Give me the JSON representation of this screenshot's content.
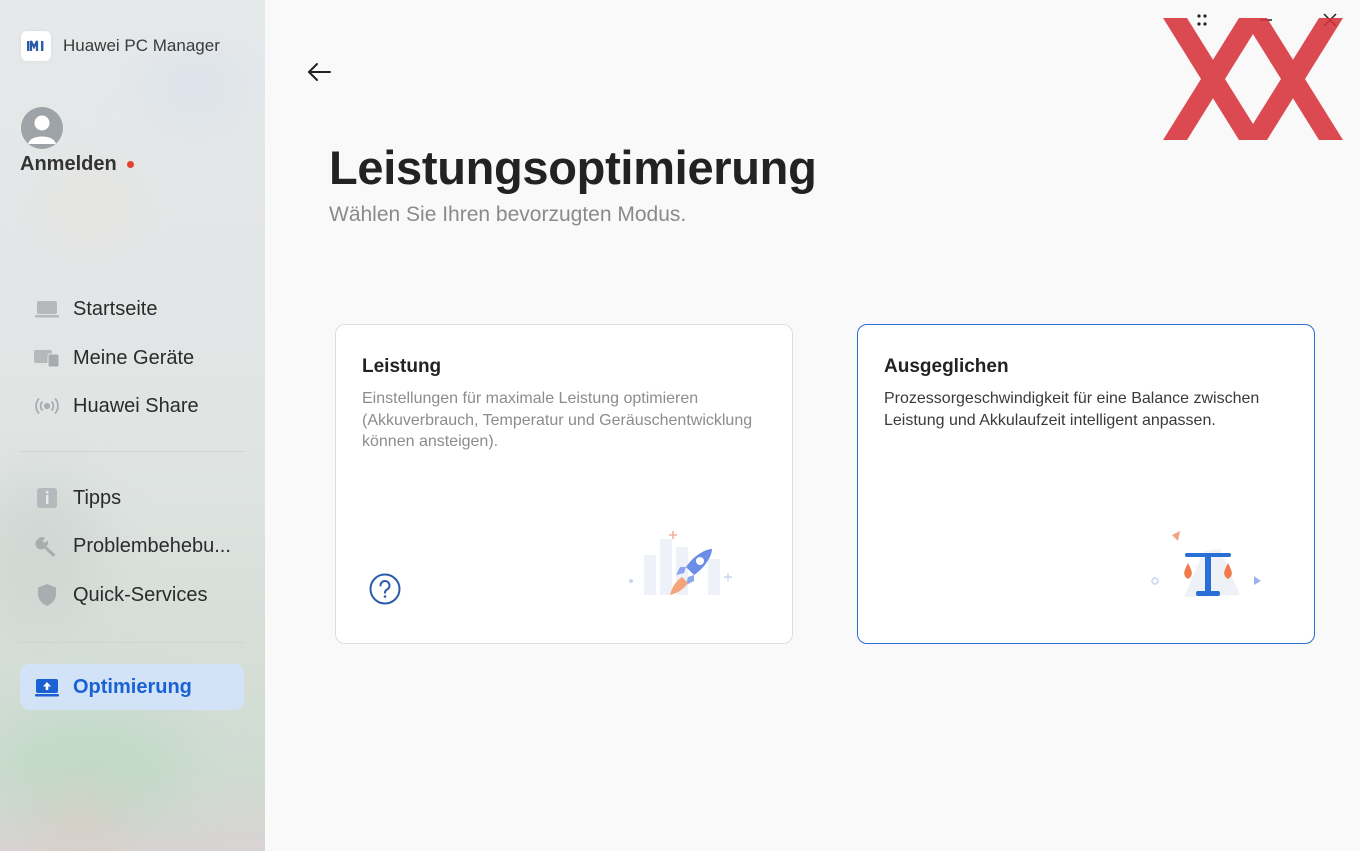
{
  "app": {
    "title": "Huawei PC Manager",
    "logo": "huawei-pc-manager-logo"
  },
  "user": {
    "login_label": "Anmelden",
    "notification_color": "#e0432f"
  },
  "sidebar": {
    "items": [
      {
        "label": "Startseite",
        "icon": "laptop-icon"
      },
      {
        "label": "Meine Geräte",
        "icon": "devices-icon"
      },
      {
        "label": "Huawei Share",
        "icon": "wireless-icon"
      },
      {
        "label": "Tipps",
        "icon": "info-icon"
      },
      {
        "label": "Problembehebu...",
        "icon": "wrench-icon"
      },
      {
        "label": "Quick-Services",
        "icon": "shield-icon"
      },
      {
        "label": "Optimierung",
        "icon": "optimize-icon",
        "active": true
      }
    ]
  },
  "main": {
    "title": "Leistungsoptimierung",
    "subtitle": "Wählen Sie Ihren bevorzugten Modus.",
    "cards": [
      {
        "title": "Leistung",
        "description": "Einstellungen für maximale Leistung optimieren (Akkuverbrauch, Temperatur und Geräuschentwicklung können ansteigen).",
        "icon": "rocket-icon",
        "selected": false
      },
      {
        "title": "Ausgeglichen",
        "description": "Prozessorgeschwindigkeit für eine Balance zwischen Leistung und Akkulaufzeit intelligent anpassen.",
        "icon": "balance-scale-icon",
        "selected": true
      }
    ]
  },
  "colors": {
    "accent": "#2a6fd6",
    "active_bg": "#d3e3f7",
    "watermark": "#d9333a"
  }
}
